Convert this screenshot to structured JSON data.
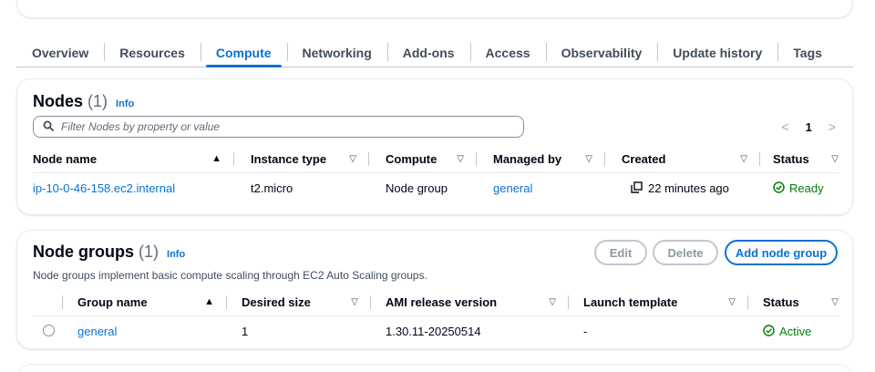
{
  "tabs": [
    "Overview",
    "Resources",
    "Compute",
    "Networking",
    "Add-ons",
    "Access",
    "Observability",
    "Update history",
    "Tags"
  ],
  "active_tab": "Compute",
  "nodes": {
    "title": "Nodes",
    "count": "(1)",
    "info": "Info",
    "filter_placeholder": "Filter Nodes by property or value",
    "pager": {
      "prev": "<",
      "page": "1",
      "next": ">"
    },
    "columns": [
      "Node name",
      "Instance type",
      "Compute",
      "Managed by",
      "Created",
      "Status"
    ],
    "rows": [
      {
        "node_name": "ip-10-0-46-158.ec2.internal",
        "instance_type": "t2.micro",
        "compute": "Node group",
        "managed_by": "general",
        "created": "22 minutes ago",
        "status": "Ready"
      }
    ]
  },
  "node_groups": {
    "title": "Node groups",
    "count": "(1)",
    "info": "Info",
    "description": "Node groups implement basic compute scaling through EC2 Auto Scaling groups.",
    "buttons": {
      "edit": "Edit",
      "delete": "Delete",
      "add": "Add node group"
    },
    "columns": [
      "Group name",
      "Desired size",
      "AMI release version",
      "Launch template",
      "Status"
    ],
    "rows": [
      {
        "group_name": "general",
        "desired_size": "1",
        "ami_release_version": "1.30.11-20250514",
        "launch_template": "-",
        "status": "Active"
      }
    ]
  },
  "colors": {
    "accent": "#0972d3",
    "success": "#037f0c",
    "text": "#000716",
    "border": "#e9ebed"
  },
  "icons": [
    "search-icon",
    "sort-ascending-icon",
    "sort-descending-icon",
    "copy-icon",
    "status-success-icon",
    "radio-button-icon",
    "chevron-left-icon",
    "chevron-right-icon"
  ]
}
